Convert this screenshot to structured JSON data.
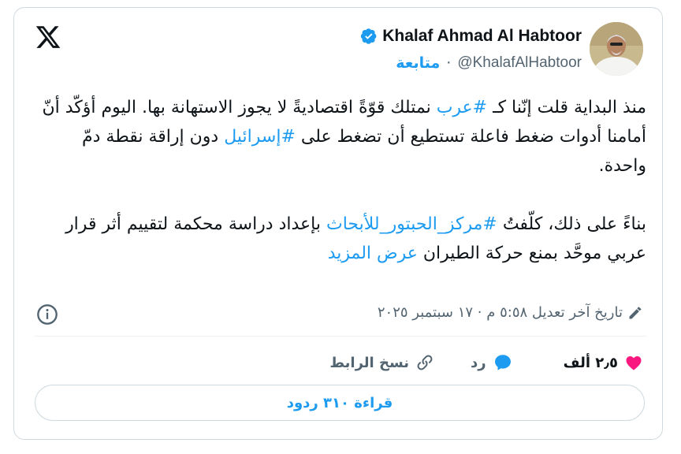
{
  "author": {
    "name": "Khalaf Ahmad Al Habtoor",
    "handle": "@KhalafAlHabtoor",
    "dot": "·",
    "follow_label": "متابعة"
  },
  "tweet": {
    "p1_part1": "منذ البداية قلت إنّنا كـ ",
    "p1_hashtag1": "#عرب",
    "p1_part2": " نمتلك قوّةً اقتصاديةً لا يجوز الاستهانة بها. اليوم أؤكّد أنّ أمامنا أدوات ضغط فاعلة تستطيع أن تضغط على ",
    "p1_hashtag2": "#إسرائيل",
    "p1_part3": " دون إراقة نقطة دمّ واحدة.",
    "p2_part1": "بناءً على ذلك، كلّفتُ ",
    "p2_hashtag": "#مركز_الحبتور_للأبحاث",
    "p2_part2": " بإعداد دراسة محكمة لتقييم أثر قرار عربي موحَّد بمنع حركة الطيران ",
    "show_more": "عرض المزيد"
  },
  "meta": {
    "timestamp": "تاريخ آخر تعديل ٥:٥٨ م · ١٧ سبتمبر ٢٠٢٥"
  },
  "actions": {
    "like_count": "٢٫٥ ألف",
    "reply_label": "رد",
    "copy_link_label": "نسخ الرابط"
  },
  "read_replies": "قراءة ٣١٠ ردود",
  "colors": {
    "accent": "#1d9bf0",
    "like": "#f91880",
    "text": "#0f1419",
    "muted": "#536471",
    "border": "#cfd9de"
  },
  "icons": [
    "x-logo-icon",
    "verified-badge-icon",
    "edit-pencil-icon",
    "info-icon",
    "heart-icon",
    "reply-bubble-icon",
    "link-icon"
  ]
}
